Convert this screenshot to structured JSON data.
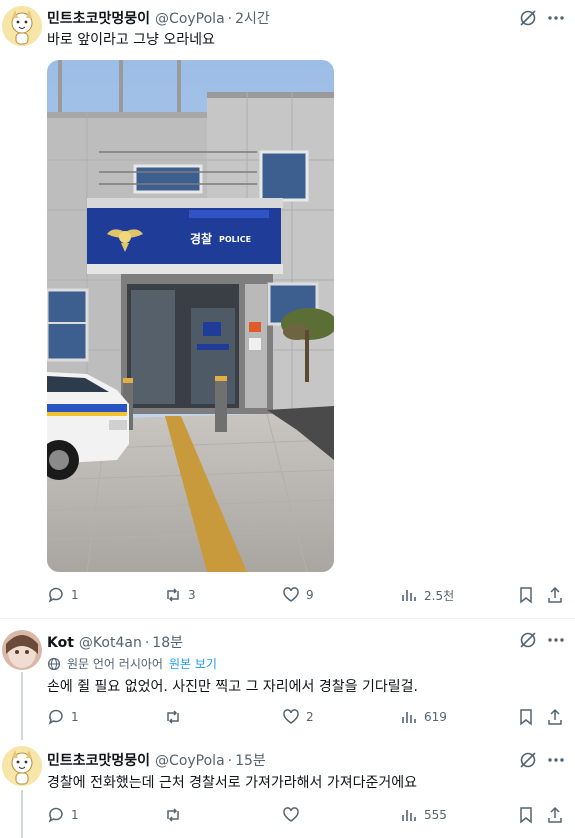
{
  "tweets": [
    {
      "name": "민트초코맛멍뭉이",
      "handle": "@CoyPola",
      "separator": "·",
      "time": "2시간",
      "text": "바로 앞이라고 그냥 오라네요",
      "photo": {
        "sign_korean": "경찰",
        "sign_english": "POLICE"
      },
      "stats": {
        "replies": "1",
        "retweets": "3",
        "likes": "9",
        "views": "2.5천"
      }
    },
    {
      "name": "Kot",
      "handle": "@Kot4an",
      "separator": "·",
      "time": "18분",
      "translation_note": "원문 언어 러시아어",
      "translation_link": "원본 보기",
      "text": "손에 쥘 필요 없었어. 사진만 찍고 그 자리에서 경찰을 기다릴걸.",
      "stats": {
        "replies": "1",
        "retweets": "",
        "likes": "2",
        "views": "619"
      }
    },
    {
      "name": "민트초코맛멍뭉이",
      "handle": "@CoyPola",
      "separator": "·",
      "time": "15분",
      "text": "경찰에 전화했는데 근처 경찰서로 가져가라해서 가져다준거에요",
      "stats": {
        "replies": "1",
        "retweets": "",
        "likes": "",
        "views": "555"
      }
    }
  ],
  "colors": {
    "text": "#0f1419",
    "secondary": "#536471",
    "link": "#1d9bf0",
    "divider": "#eff3f4"
  }
}
